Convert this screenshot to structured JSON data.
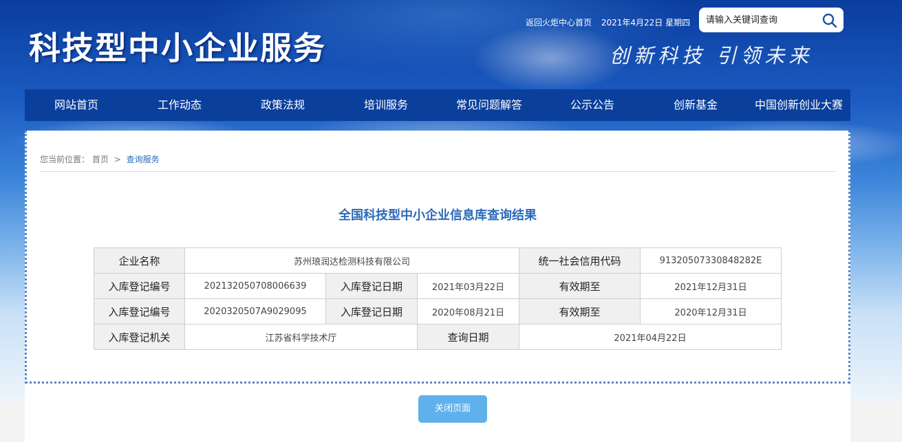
{
  "header": {
    "site_title": "科技型中小企业服务",
    "home_link": "返回火炬中心首页",
    "date": "2021年4月22日 星期四",
    "slogan": "创新科技 引领未来",
    "search": {
      "placeholder": "请输入关键词查询"
    }
  },
  "nav": {
    "items": [
      {
        "label": "网站首页"
      },
      {
        "label": "工作动态"
      },
      {
        "label": "政策法规"
      },
      {
        "label": "培训服务"
      },
      {
        "label": "常见问题解答"
      },
      {
        "label": "公示公告"
      },
      {
        "label": "创新基金"
      },
      {
        "label": "中国创新创业大赛"
      }
    ]
  },
  "breadcrumb": {
    "prefix": "您当前位置：",
    "home": "首页",
    "separator": ">",
    "current": "查询服务"
  },
  "result": {
    "title": "全国科技型中小企业信息库查询结果",
    "labels": {
      "company_name": "企业名称",
      "credit_code": "统一社会信用代码",
      "reg_no": "入库登记编号",
      "reg_date": "入库登记日期",
      "valid_until": "有效期至",
      "reg_authority": "入库登记机关",
      "query_date": "查询日期"
    },
    "company_name": "苏州琅润达检测科技有限公司",
    "credit_code": "91320507330848282E",
    "records": [
      {
        "reg_no": "202132050708006639",
        "reg_date": "2021年03月22日",
        "valid_until": "2021年12月31日"
      },
      {
        "reg_no": "2020320507A9029095",
        "reg_date": "2020年08月21日",
        "valid_until": "2020年12月31日"
      }
    ],
    "reg_authority": "江苏省科学技术厅",
    "query_date": "2021年04月22日"
  },
  "actions": {
    "close_label": "关闭页面"
  },
  "colors": {
    "nav_bg": "#0a3f9c",
    "title_blue": "#2a6ab8",
    "button_bg": "#5fb1ec"
  }
}
